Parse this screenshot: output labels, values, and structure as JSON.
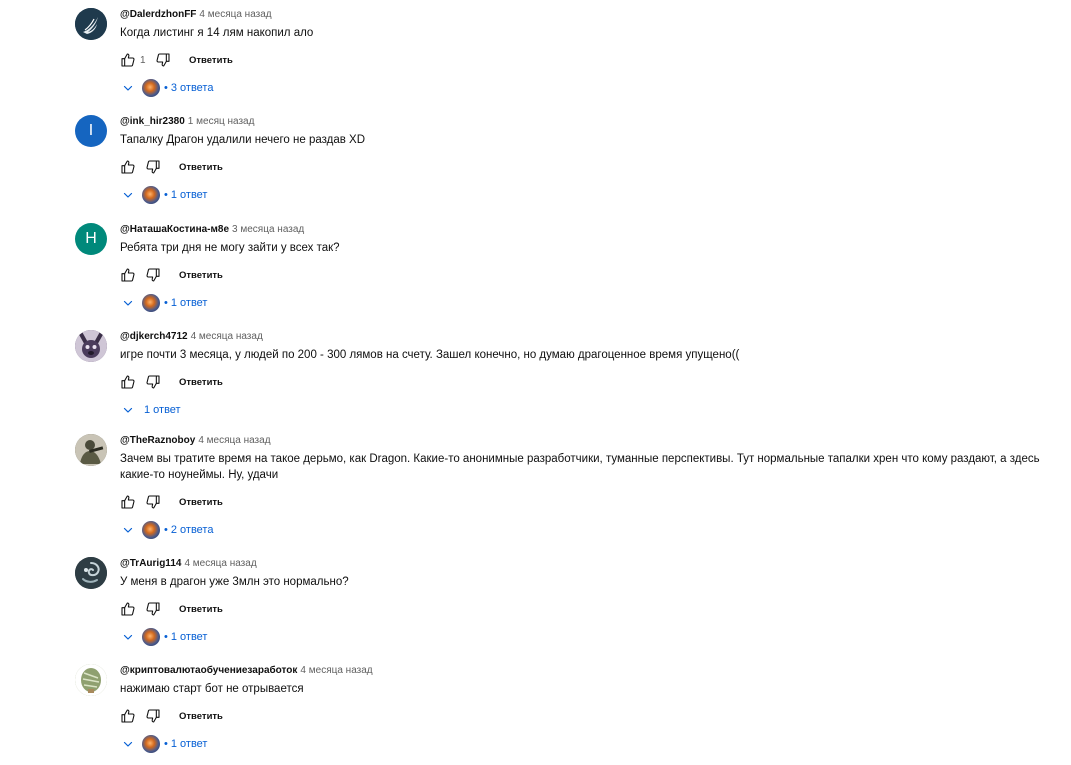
{
  "comments": [
    {
      "author": "@DalerdzhonFF",
      "time": "4 месяца назад",
      "text": "Когда листинг я 14 лям накопил ало",
      "likes": "1",
      "reply_label": "Ответить",
      "replies_label": "3 ответа",
      "avatar_type": "wing-logo",
      "avatar_color": "#1f3a4d",
      "has_reply_avatar": true
    },
    {
      "author": "@ink_hir2380",
      "time": "1 месяц назад",
      "text": "Тапалку Драгон удалили нечего не раздав XD",
      "likes": "",
      "reply_label": "Ответить",
      "replies_label": "1 ответ",
      "avatar_letter": "I",
      "avatar_color": "#1565c0",
      "has_reply_avatar": true
    },
    {
      "author": "@НаташаКостина-м8е",
      "time": "3 месяца назад",
      "text": "Ребята три дня не могу зайти у всех так?",
      "likes": "",
      "reply_label": "Ответить",
      "replies_label": "1 ответ",
      "avatar_letter": "Н",
      "avatar_color": "#00897b",
      "has_reply_avatar": true
    },
    {
      "author": "@djkerch4712",
      "time": "4 месяца назад",
      "text": "игре почти 3 месяца, у людей по 200 - 300 лямов на счету. Зашел конечно, но думаю драгоценное время упущено((",
      "likes": "",
      "reply_label": "Ответить",
      "replies_label": "1 ответ",
      "avatar_type": "dog-photo",
      "avatar_color": "#5b4a6e",
      "has_reply_avatar": false
    },
    {
      "author": "@TheRaznoboy",
      "time": "4 месяца назад",
      "text": "Зачем вы тратите время на такое дерьмо, как Dragon. Какие-то анонимные разработчики, туманные перспективы. Тут нормальные тапалки хрен что кому раздают, а здесь какие-то ноунеймы. Ну, удачи",
      "likes": "",
      "reply_label": "Ответить",
      "replies_label": "2 ответа",
      "avatar_type": "soldier-photo",
      "avatar_color": "#5a5a4a",
      "has_reply_avatar": true
    },
    {
      "author": "@TrAurig114",
      "time": "4 месяца назад",
      "text": "У меня в драгон уже 3млн это нормально?",
      "likes": "",
      "reply_label": "Ответить",
      "replies_label": "1 ответ",
      "avatar_type": "swirl-photo",
      "avatar_color": "#2e3d44",
      "has_reply_avatar": true
    },
    {
      "author": "@криптовалютаобучениезаработок",
      "time": "4 месяца назад",
      "text": "нажимаю старт бот не отрывается",
      "likes": "",
      "reply_label": "Ответить",
      "replies_label": "1 ответ",
      "avatar_type": "money-photo",
      "avatar_color": "#8a9a6a",
      "has_reply_avatar": true
    }
  ],
  "colors": {
    "link": "#065fd4",
    "meta": "#606060",
    "text": "#0f0f0f"
  }
}
